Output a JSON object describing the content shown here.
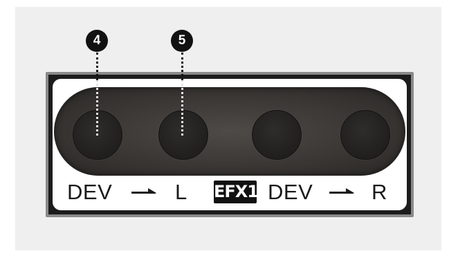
{
  "callouts": [
    {
      "number": "4",
      "target": "jack-1"
    },
    {
      "number": "5",
      "target": "jack-2"
    }
  ],
  "panel": {
    "labels": {
      "left_dev": "DEV",
      "left_channel": "L",
      "efx_badge": "EFX1",
      "right_dev": "DEV",
      "right_channel": "R"
    },
    "jack_count": 4,
    "colors": {
      "background": "#efefef",
      "strip": "#3a3734",
      "jack": "#232120",
      "callout": "#121212"
    }
  }
}
